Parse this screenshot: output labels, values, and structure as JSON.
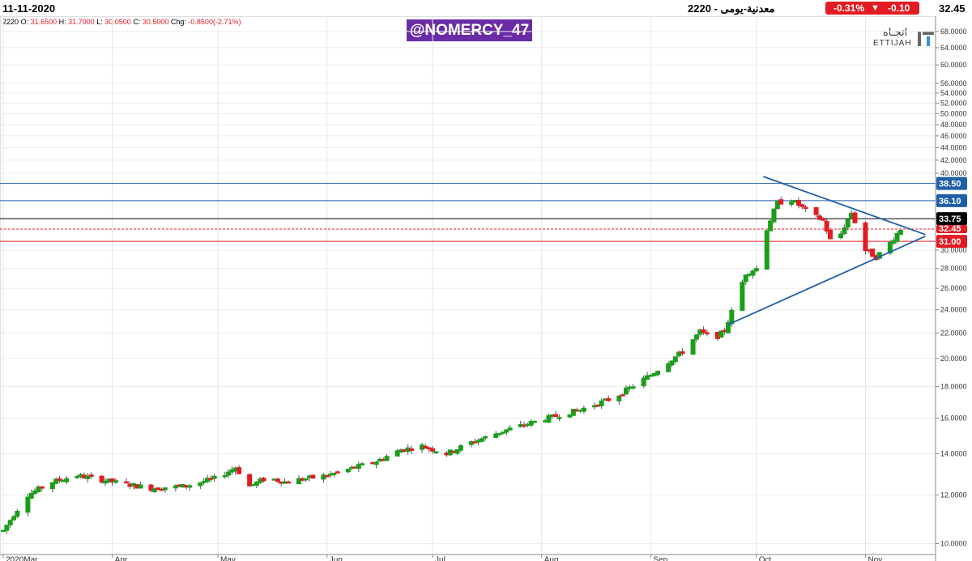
{
  "header": {
    "date": "11-11-2020",
    "title": "معدنية-يومى  -  2220",
    "change_pct": "-0.31%",
    "change_abs": "-0.10",
    "last_price": "32.45"
  },
  "ohlc": {
    "symbol": "2220",
    "o_label": "O:",
    "o": "31.6500",
    "h_label": "H:",
    "h": "31.7000",
    "l_label": "L:",
    "l": "30.0500",
    "c_label": "C:",
    "c": "30.5000",
    "chg_label": "Chg:",
    "chg": "-0.8500(-2.71%)"
  },
  "watermark": "@NOMERCY_47",
  "logo": {
    "ar": "اتجـاه",
    "en": "ETTIJAH"
  },
  "colors": {
    "up": "#1a9e1a",
    "down": "#e31b23",
    "trend": "#1f5fa8",
    "black_line": "#000000"
  },
  "chart_data": {
    "type": "candlestick",
    "y_scale": "log",
    "ylim": [
      9.6,
      72
    ],
    "y_ticks": [
      {
        "value": 10,
        "label": "10.0000"
      },
      {
        "value": 12,
        "label": "12.0000"
      },
      {
        "value": 14,
        "label": "14.0000"
      },
      {
        "value": 16,
        "label": "16.0000"
      },
      {
        "value": 18,
        "label": "18.0000"
      },
      {
        "value": 20,
        "label": "20.0000"
      },
      {
        "value": 22,
        "label": "22.0000"
      },
      {
        "value": 24,
        "label": "24.0000"
      },
      {
        "value": 26,
        "label": "26.0000"
      },
      {
        "value": 28,
        "label": "28.0000"
      },
      {
        "value": 30,
        "label": "30.0000"
      },
      {
        "value": 40,
        "label": "40.0000"
      },
      {
        "value": 42,
        "label": "42.0000"
      },
      {
        "value": 44,
        "label": "44.0000"
      },
      {
        "value": 46,
        "label": "46.0000"
      },
      {
        "value": 48,
        "label": "48.0000"
      },
      {
        "value": 50,
        "label": "50.0000"
      },
      {
        "value": 52,
        "label": "52.0000"
      },
      {
        "value": 54,
        "label": "54.0000"
      },
      {
        "value": 56,
        "label": "56.0000"
      },
      {
        "value": 60,
        "label": "60.0000"
      },
      {
        "value": 64,
        "label": "64.0000"
      },
      {
        "value": 68,
        "label": "68.0000"
      }
    ],
    "x_ticks": [
      {
        "date": "2020-03-01",
        "label": "2020Mar"
      },
      {
        "date": "2020-04-01",
        "label": "Apr"
      },
      {
        "date": "2020-05-01",
        "label": "May"
      },
      {
        "date": "2020-06-01",
        "label": "Jun"
      },
      {
        "date": "2020-07-01",
        "label": "Jul"
      },
      {
        "date": "2020-08-01",
        "label": "Aug"
      },
      {
        "date": "2020-09-01",
        "label": "Sep"
      },
      {
        "date": "2020-10-01",
        "label": "Oct"
      },
      {
        "date": "2020-11-01",
        "label": "Nov"
      }
    ],
    "x_range": [
      "2020-03-01",
      "2020-11-20"
    ],
    "levels": [
      {
        "value": 38.5,
        "label": "38.50",
        "color": "#1f5fa8"
      },
      {
        "value": 36.1,
        "label": "36.10",
        "color": "#1f5fa8"
      },
      {
        "value": 33.75,
        "label": "33.75",
        "color": "#000000"
      },
      {
        "value": 32.45,
        "label": "32.45",
        "color": "#e31b23",
        "dashed": true
      },
      {
        "value": 31.0,
        "label": "31.00",
        "color": "#e31b23"
      }
    ],
    "trendlines": [
      {
        "from": [
          "2020-09-23",
          22.7
        ],
        "to": [
          "2020-11-18",
          31.6
        ],
        "color": "#1f5fa8"
      },
      {
        "from": [
          "2020-10-03",
          39.5
        ],
        "to": [
          "2020-11-18",
          31.8
        ],
        "color": "#1f5fa8"
      }
    ],
    "anchors": [
      [
        "2020-03-01",
        10.5
      ],
      [
        "2020-03-08",
        12.0
      ],
      [
        "2020-03-15",
        12.6
      ],
      [
        "2020-03-22",
        12.9
      ],
      [
        "2020-04-01",
        12.6
      ],
      [
        "2020-04-12",
        12.3
      ],
      [
        "2020-04-22",
        12.4
      ],
      [
        "2020-05-01",
        12.8
      ],
      [
        "2020-05-06",
        13.3
      ],
      [
        "2020-05-10",
        12.4
      ],
      [
        "2020-05-15",
        12.8
      ],
      [
        "2020-05-20",
        12.6
      ],
      [
        "2020-06-01",
        12.9
      ],
      [
        "2020-06-15",
        13.6
      ],
      [
        "2020-06-22",
        14.2
      ],
      [
        "2020-06-28",
        14.4
      ],
      [
        "2020-07-05",
        14.0
      ],
      [
        "2020-07-12",
        14.6
      ],
      [
        "2020-07-22",
        15.3
      ],
      [
        "2020-08-01",
        15.9
      ],
      [
        "2020-08-12",
        16.5
      ],
      [
        "2020-08-22",
        17.3
      ],
      [
        "2020-09-01",
        18.8
      ],
      [
        "2020-09-10",
        20.5
      ],
      [
        "2020-09-15",
        22.1
      ],
      [
        "2020-09-19",
        21.5
      ],
      [
        "2020-09-22",
        22.2
      ],
      [
        "2020-09-24",
        23.8
      ],
      [
        "2020-09-28",
        27.5
      ],
      [
        "2020-10-01",
        28.0
      ],
      [
        "2020-10-04",
        32.5
      ],
      [
        "2020-10-07",
        35.8
      ],
      [
        "2020-10-11",
        36.2
      ],
      [
        "2020-10-16",
        34.5
      ],
      [
        "2020-10-20",
        33.5
      ],
      [
        "2020-10-23",
        30.0
      ],
      [
        "2020-10-26",
        32.8
      ],
      [
        "2020-10-28",
        34.5
      ],
      [
        "2020-11-01",
        30.0
      ],
      [
        "2020-11-04",
        29.2
      ],
      [
        "2020-11-08",
        30.8
      ],
      [
        "2020-11-11",
        32.45
      ]
    ]
  }
}
